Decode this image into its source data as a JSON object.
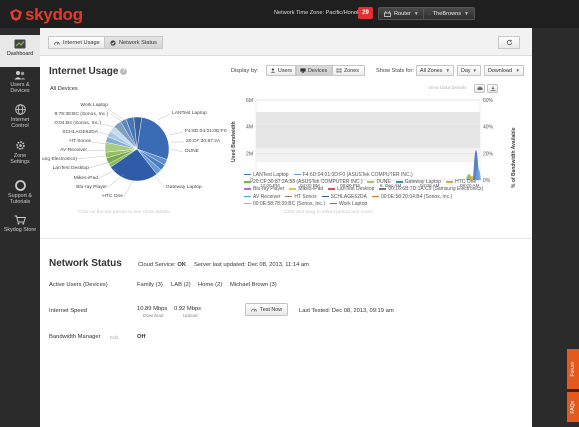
{
  "header": {
    "brand": "skydog",
    "network_time": "Network Time Zone: Pacific/Honolulu",
    "alert_count": "29",
    "router_label": "Router",
    "account_label": "TheBrowns"
  },
  "sidebar": {
    "items": [
      {
        "label1": "Dashboard",
        "label2": ""
      },
      {
        "label1": "Users &",
        "label2": "Devices"
      },
      {
        "label1": "Internet",
        "label2": "Control"
      },
      {
        "label1": "Zone",
        "label2": "Settings"
      },
      {
        "label1": "Support &",
        "label2": "Tutorials"
      },
      {
        "label1": "Skydog Store",
        "label2": ""
      }
    ]
  },
  "subtabs": {
    "internet_usage": "Internet Usage",
    "network_status": "Network Status"
  },
  "usage": {
    "title": "Internet Usage",
    "display_by": "Display by:",
    "buttons": {
      "users": "Users",
      "devices": "Devices",
      "zones": "Zones"
    },
    "show_stats": "Show Stats for:",
    "zone_select": "All Zones",
    "period_select": "Day",
    "direction_select": "Download",
    "all_devices": "All Devices",
    "view_details": "View Data Details",
    "pie_hint": "Click on the pie pieces to see more details.",
    "graph_hint": "Click and drag to select period and zoom.",
    "pie_labels": [
      "Work Laptop",
      "8:78:39:BC (Sonos, Inc.)",
      ":0:04:B4 (Sonos, Inc.)",
      "SCHLAGE62DA",
      "HT Sonos",
      "AV Receiver",
      "ung Electronics)",
      "LanTest Desktop",
      "Mikes-iPad",
      "Blu-ray Player",
      "HTC One",
      "LANTest Laptop",
      "F4:6D:04:01:0D:F0",
      "20:CF:30:87:2A",
      "DUNE",
      "Gateway Laptop"
    ],
    "legend": [
      {
        "name": "LANTest Laptop",
        "color": "#3c6fb8"
      },
      {
        "name": "F4:6D:04:01:0D:F0 (ASUSTek COMPUTER INC.)",
        "color": "#6aa0d8"
      },
      {
        "name": "20:CF:30:87:2A:58 (ASUSTek COMPUTER INC.)",
        "color": "#7ab648"
      },
      {
        "name": "DUNE",
        "color": "#a5c96a"
      },
      {
        "name": "Gateway Laptop",
        "color": "#2e9a9a"
      },
      {
        "name": "HTC One",
        "color": "#e8a23a"
      },
      {
        "name": "Blu-ray Player",
        "color": "#b06fc4"
      },
      {
        "name": "Mikes-iPad",
        "color": "#e0c342"
      },
      {
        "name": "LanTest Desktop",
        "color": "#d94f4f"
      },
      {
        "name": "00:16:6B:7D:1A:C9 (Samsung Electronics)",
        "color": "#777777"
      },
      {
        "name": "AV Receiver",
        "color": "#56a8c4"
      },
      {
        "name": "HT Sonos",
        "color": "#9a7b4f"
      },
      {
        "name": "SCHLAGE62DA",
        "color": "#2a5d7d"
      },
      {
        "name": "00:0E:58:20:04:B4 (Sonos, Inc.)",
        "color": "#c77a45"
      },
      {
        "name": "00:0E:58:78:39:BC (Sonos, Inc.)",
        "color": "#8fb5d9"
      },
      {
        "name": "Work Laptop",
        "color": "#5c8f3e"
      }
    ]
  },
  "chart_data": {
    "type": "area",
    "ylabel": "Used Bandwidth",
    "y2label": "% of Bandwidth Available",
    "y_ticks": [
      "6M",
      "4M",
      "2M",
      "0"
    ],
    "y2_ticks": [
      "60%",
      "40%",
      "20%",
      "0%"
    ],
    "x_ticks": [
      "12:00 PM",
      "04:00 PM",
      "08:00 PM",
      "8. Dec AM",
      "04:00 AM",
      "08:00 AM"
    ],
    "pie": {
      "slices": [
        {
          "label": "LANTest Laptop",
          "value": 28,
          "color": "#3a6bb5"
        },
        {
          "label": "F4:6D:04:01:0D:F0",
          "value": 3,
          "color": "#5d8fd0"
        },
        {
          "label": "20:CF:30:87:2A",
          "value": 3,
          "color": "#4a7cc0"
        },
        {
          "label": "DUNE",
          "value": 3,
          "color": "#6a9bd8"
        },
        {
          "label": "Gateway Laptop",
          "value": 26,
          "color": "#2f5ca8"
        },
        {
          "label": "HTC One",
          "value": 2,
          "color": "#8ab85a"
        },
        {
          "label": "Blu-ray Player",
          "value": 3,
          "color": "#79a94a"
        },
        {
          "label": "Mikes-iPad",
          "value": 3,
          "color": "#92bf66"
        },
        {
          "label": "LanTest Desktop",
          "value": 5,
          "color": "#a7cc7e"
        },
        {
          "label": "ung Electronics)",
          "value": 3,
          "color": "#7eaed6"
        },
        {
          "label": "AV Receiver",
          "value": 3,
          "color": "#a9c9e6"
        },
        {
          "label": "HT Sonos",
          "value": 3,
          "color": "#c5dbef"
        },
        {
          "label": "SCHLAGE62DA",
          "value": 4,
          "color": "#7d9fc2"
        },
        {
          "label": ":0:04:B4 (Sonos, Inc.)",
          "value": 3,
          "color": "#5a86b8"
        },
        {
          "label": "8:78:39:BC (Sonos, Inc.)",
          "value": 4,
          "color": "#4577b3"
        },
        {
          "label": "Work Laptop",
          "value": 4,
          "color": "#375f9c"
        }
      ]
    }
  },
  "network_status": {
    "title": "Network Status",
    "cloud_service_label": "Cloud Service:",
    "cloud_service_value": "OK",
    "server_updated_label": "Server last updated:",
    "server_updated_value": "Dec 08, 2013, 11:14 am",
    "active_users_label": "Active Users (Devices)",
    "users": [
      "Family (3)",
      "LAB (2)",
      "Home (2)",
      "Michael Brown (3)"
    ],
    "internet_speed_label": "Internet Speed",
    "download_value": "10.89 Mbps",
    "download_label": "Download",
    "upload_value": "0.92 Mbps",
    "upload_label": "Upload",
    "test_now": "Test Now",
    "last_tested_label": "Last Tested:",
    "last_tested_value": "Dec 08, 2013, 09:19 am",
    "bw_manager_label": "Bandwidth Manager",
    "bw_manager_edit": "Edit",
    "bw_manager_value": "Off"
  },
  "side_tabs": {
    "forum": "Forum",
    "faq": "FAQs"
  }
}
